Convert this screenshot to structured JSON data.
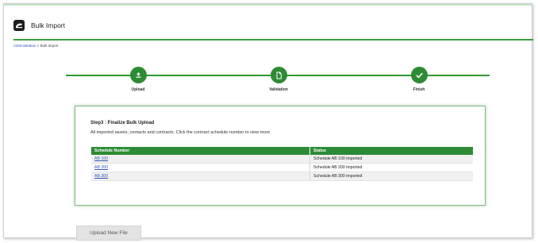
{
  "app": {
    "title": "Bulk Import",
    "logo_icon": "app-logo-icon"
  },
  "breadcrumb": {
    "parent": "Administration",
    "separator": " > ",
    "current": "Bulk Import"
  },
  "stepper": {
    "steps": [
      {
        "label": "Upload",
        "icon": "upload-icon",
        "state": "complete"
      },
      {
        "label": "Validation",
        "icon": "document-icon",
        "state": "complete"
      },
      {
        "label": "Finish",
        "icon": "check-icon",
        "state": "complete"
      }
    ]
  },
  "panel": {
    "title": "Step3 : Finalize Bulk Upload",
    "description": "All imported assets, contacts and contracts. Click the contract schedule number to view more."
  },
  "table": {
    "columns": [
      "Schedule Number",
      "Status"
    ],
    "rows": [
      {
        "schedule": "AB 100",
        "status": "Schedule AB 100 imported"
      },
      {
        "schedule": "AB 200",
        "status": "Schedule AB 200 imported"
      },
      {
        "schedule": "AB 300",
        "status": "Schedule AB 300 imported"
      }
    ]
  },
  "actions": {
    "upload_new_label": "Upload New File"
  },
  "colors": {
    "accent_green": "#2e8b35",
    "link_blue": "#2d56b6"
  }
}
